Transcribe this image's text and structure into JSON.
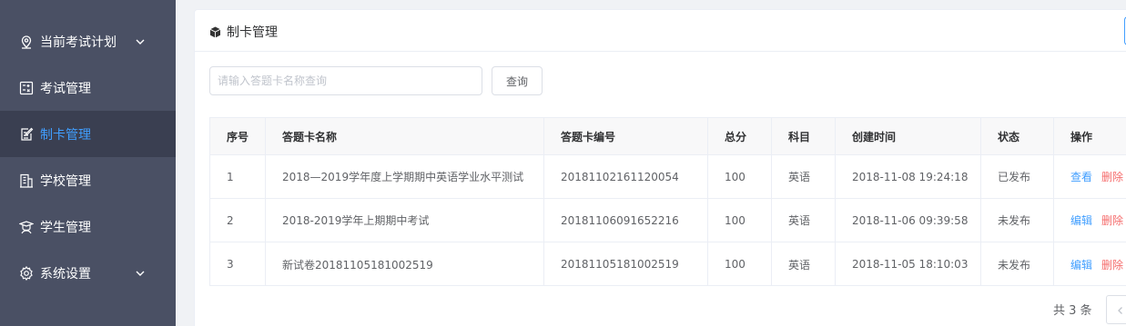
{
  "sidebar": {
    "items": [
      {
        "label": "当前考试计划",
        "icon": "location-pin-icon",
        "has_chevron": true
      },
      {
        "label": "考试管理",
        "icon": "calculator-icon",
        "has_chevron": false
      },
      {
        "label": "制卡管理",
        "icon": "edit-card-icon",
        "has_chevron": false,
        "active": true
      },
      {
        "label": "学校管理",
        "icon": "building-icon",
        "has_chevron": false
      },
      {
        "label": "学生管理",
        "icon": "graduation-cap-icon",
        "has_chevron": false
      },
      {
        "label": "系统设置",
        "icon": "gear-icon",
        "has_chevron": true
      }
    ]
  },
  "panel": {
    "title": "制卡管理",
    "title_icon": "cube-icon"
  },
  "search": {
    "placeholder": "请输入答题卡名称查询",
    "button_label": "查询"
  },
  "table": {
    "columns": [
      "序号",
      "答题卡名称",
      "答题卡编号",
      "总分",
      "科目",
      "创建时间",
      "状态",
      "操作"
    ],
    "rows": [
      {
        "index": "1",
        "name": "2018—2019学年度上学期期中英语学业水平测试",
        "code": "20181102161120054",
        "score": "100",
        "subject": "英语",
        "created": "2018-11-08 19:24:18",
        "status": "已发布",
        "op1": "查看",
        "op2": "删除"
      },
      {
        "index": "2",
        "name": "2018-2019学年上期期中考试",
        "code": "20181106091652216",
        "score": "100",
        "subject": "英语",
        "created": "2018-11-06 09:39:58",
        "status": "未发布",
        "op1": "编辑",
        "op2": "删除"
      },
      {
        "index": "3",
        "name": "新试卷20181105181002519",
        "code": "20181105181002519",
        "score": "100",
        "subject": "英语",
        "created": "2018-11-05 18:10:03",
        "status": "未发布",
        "op1": "编辑",
        "op2": "删除"
      }
    ]
  },
  "pagination": {
    "total_text": "共 3 条"
  },
  "colors": {
    "sidebar_bg": "#4a5064",
    "sidebar_active_bg": "#3a3f51",
    "accent": "#409eff",
    "danger": "#f56c6c"
  }
}
